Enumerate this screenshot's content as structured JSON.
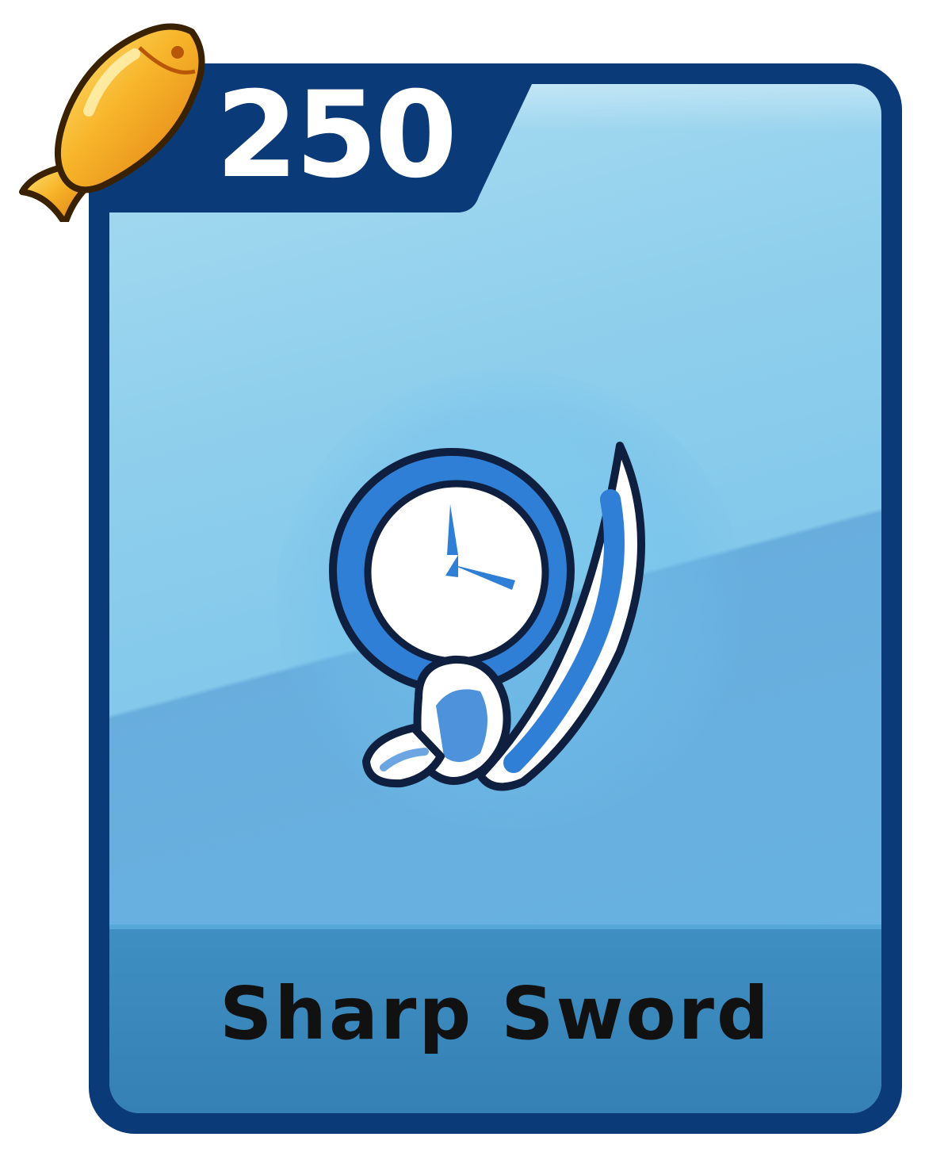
{
  "item": {
    "price": "250",
    "name": "Sharp Sword",
    "currency_icon": "fish-icon",
    "item_icon": "clock-sword-icon"
  },
  "colors": {
    "card_border": "#0b3a78",
    "card_background": "#8fcfec",
    "name_bar": "#3a88bc",
    "price_text": "#ffffff",
    "name_text": "#111111",
    "fish": "#f2a21c"
  }
}
